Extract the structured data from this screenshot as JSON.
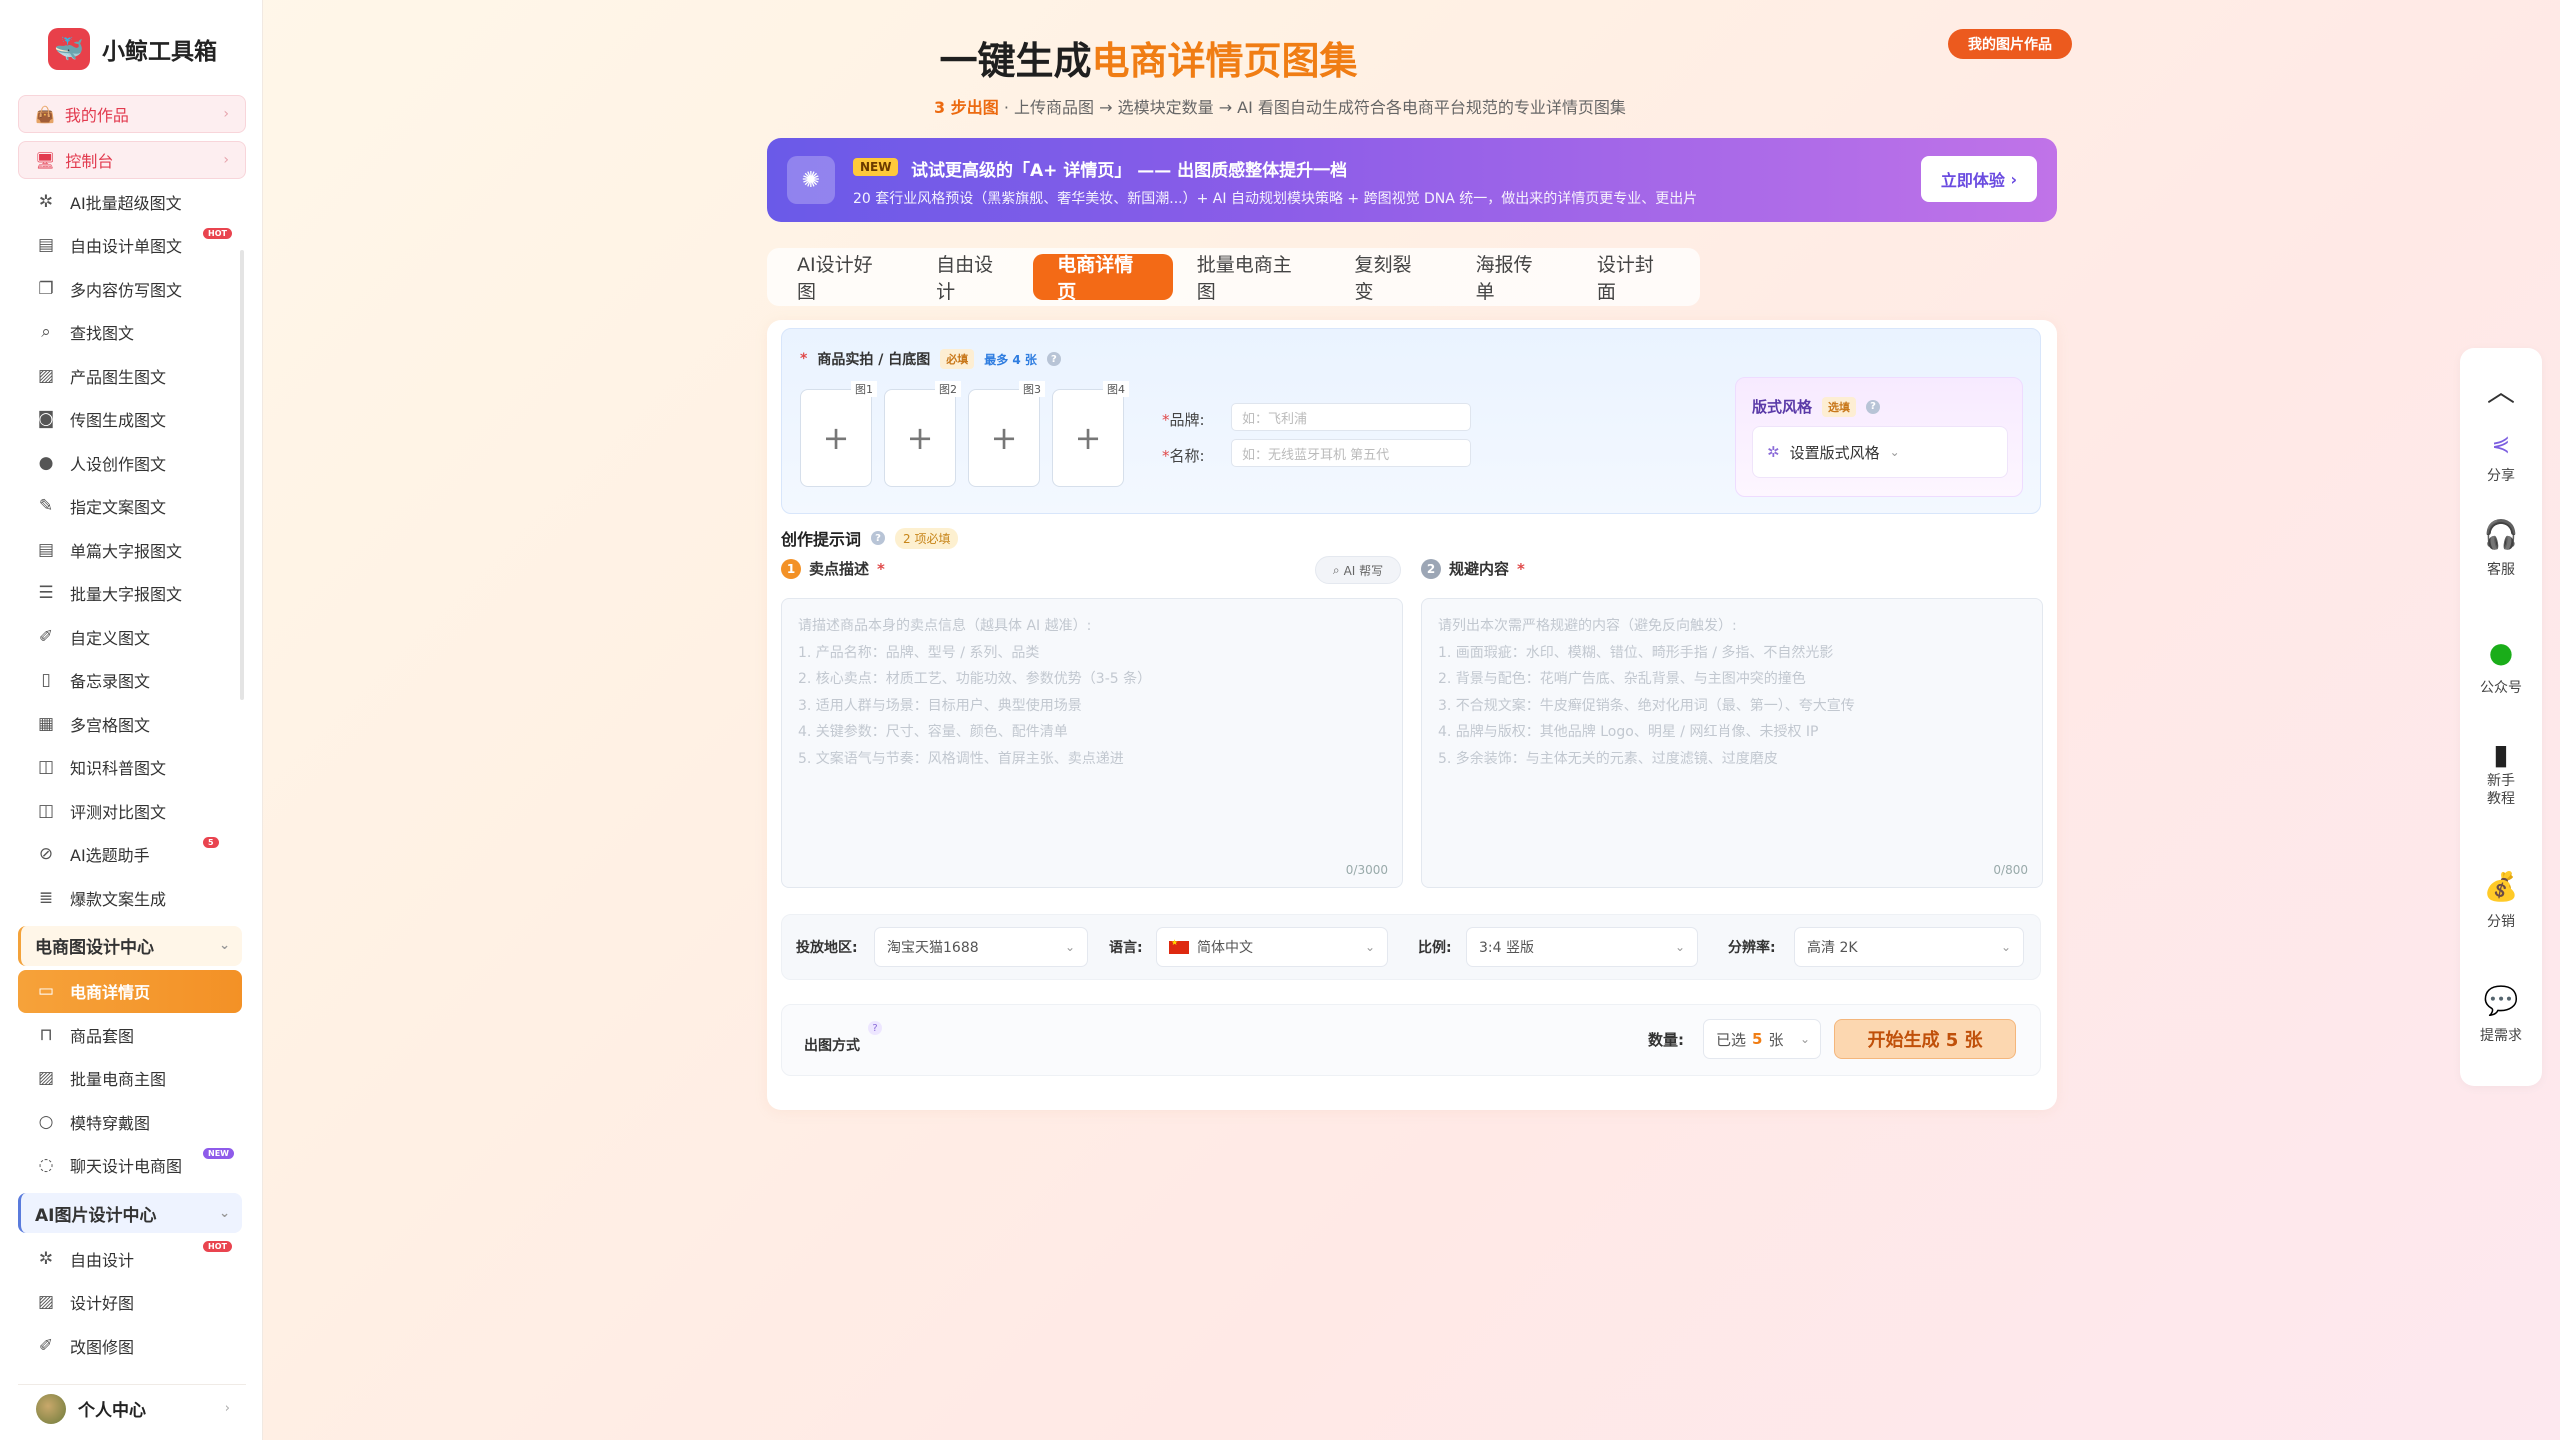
{
  "app": {
    "name": "小鲸工具箱"
  },
  "sidebar": {
    "pills": [
      {
        "label": "我的作品"
      },
      {
        "label": "控制台"
      }
    ],
    "items": [
      {
        "label": "AI批量超级图文",
        "icon": "sparkle-icon"
      },
      {
        "label": "自由设计单图文",
        "icon": "document-icon",
        "badge": "HOT"
      },
      {
        "label": "多内容仿写图文",
        "icon": "copy-icon"
      },
      {
        "label": "查找图文",
        "icon": "search-icon"
      },
      {
        "label": "产品图生图文",
        "icon": "image-icon"
      },
      {
        "label": "传图生成图文",
        "icon": "camera-icon"
      },
      {
        "label": "人设创作图文",
        "icon": "person-icon"
      },
      {
        "label": "指定文案图文",
        "icon": "edit-icon"
      },
      {
        "label": "单篇大字报图文",
        "icon": "document-icon"
      },
      {
        "label": "批量大字报图文",
        "icon": "stack-icon"
      },
      {
        "label": "自定义图文",
        "icon": "pen-icon"
      },
      {
        "label": "备忘录图文",
        "icon": "notebook-icon"
      },
      {
        "label": "多宫格图文",
        "icon": "grid-icon"
      },
      {
        "label": "知识科普图文",
        "icon": "book-icon"
      },
      {
        "label": "评测对比图文",
        "icon": "book-icon"
      },
      {
        "label": "AI选题助手",
        "icon": "compass-icon",
        "badge": "5"
      },
      {
        "label": "爆款文案生成",
        "icon": "list-icon"
      }
    ],
    "section1": {
      "label": "电商图设计中心"
    },
    "section1_items": [
      {
        "label": "电商详情页",
        "icon": "layers-icon"
      },
      {
        "label": "商品套图",
        "icon": "bag-icon"
      },
      {
        "label": "批量电商主图",
        "icon": "image-icon"
      },
      {
        "label": "模特穿戴图",
        "icon": "person-icon"
      },
      {
        "label": "聊天设计电商图",
        "icon": "chat-icon",
        "badge": "NEW"
      }
    ],
    "section2": {
      "label": "AI图片设计中心"
    },
    "section2_items": [
      {
        "label": "自由设计",
        "icon": "sparkle-icon",
        "badge": "HOT"
      },
      {
        "label": "设计好图",
        "icon": "image-icon"
      },
      {
        "label": "改图修图",
        "icon": "pen-icon"
      }
    ],
    "user": {
      "label": "个人中心"
    }
  },
  "header": {
    "title_main": "一键生成",
    "title_accent": "电商详情页图集",
    "subtitle_accent": "3 步出图",
    "subtitle_rest": " · 上传商品图 → 选模块定数量 → AI 看图自动生成符合各电商平台规范的专业详情页图集",
    "my_works": "我的图片作品"
  },
  "banner": {
    "tag": "NEW",
    "title": "试试更高级的「A+ 详情页」 —— 出图质感整体提升一档",
    "subtitle": "20 套行业风格预设（黑紫旗舰、奢华美妆、新国潮...）+ AI 自动规划模块策略 + 跨图视觉 DNA 统一，做出来的详情页更专业、更出片",
    "button": "立即体验"
  },
  "tabs": [
    {
      "label": "AI设计好图"
    },
    {
      "label": "自由设计"
    },
    {
      "label": "电商详情页"
    },
    {
      "label": "批量电商主图"
    },
    {
      "label": "复刻裂变"
    },
    {
      "label": "海报传单"
    },
    {
      "label": "设计封面"
    }
  ],
  "upload": {
    "label": "商品实拍 / 白底图",
    "required_tag": "必填",
    "max_tag": "最多 4 张",
    "slots": [
      "图1",
      "图2",
      "图3",
      "图4"
    ],
    "brand_label": "品牌:",
    "brand_placeholder": "如：飞利浦",
    "name_label": "名称:",
    "name_placeholder": "如：无线蓝牙耳机 第五代",
    "style_title": "版式风格",
    "style_tag": "选填",
    "style_button": "设置版式风格"
  },
  "prompt": {
    "title": "创作提示词",
    "required_tag": "2 项必填",
    "selling": {
      "num": "1",
      "title": "卖点描述",
      "ai_button": "AI 帮写",
      "placeholder_lines": [
        "请描述商品本身的卖点信息（越具体 AI 越准）:",
        "1. 产品名称：品牌、型号 / 系列、品类",
        "2. 核心卖点：材质工艺、功能功效、参数优势（3-5 条）",
        "3. 适用人群与场景：目标用户、典型使用场景",
        "4. 关键参数：尺寸、容量、颜色、配件清单",
        "5. 文案语气与节奏：风格调性、首屏主张、卖点递进"
      ],
      "count": "0/3000"
    },
    "avoid": {
      "num": "2",
      "title": "规避内容",
      "placeholder_lines": [
        "请列出本次需严格规避的内容（避免反向触发）:",
        "1. 画面瑕疵：水印、模糊、错位、畸形手指 / 多指、不自然光影",
        "2. 背景与配色：花哨广告底、杂乱背景、与主图冲突的撞色",
        "3. 不合规文案：牛皮癣促销条、绝对化用词（最、第一）、夸大宣传",
        "4. 品牌与版权：其他品牌 Logo、明星 / 网红肖像、未授权 IP",
        "5. 多余装饰：与主体无关的元素、过度滤镜、过度磨皮"
      ],
      "count": "0/800"
    }
  },
  "options": {
    "region_label": "投放地区:",
    "region_value": "淘宝天猫1688",
    "lang_label": "语言:",
    "lang_value": "简体中文",
    "ratio_label": "比例:",
    "ratio_value": "3:4 竖版",
    "res_label": "分辨率:",
    "res_value": "高清 2K"
  },
  "generate": {
    "mode_label": "出图方式",
    "qty_label": "数量:",
    "qty_prefix": "已选",
    "qty_value": "5",
    "qty_suffix": "张",
    "button": "开始生成 5 张"
  },
  "dock": [
    {
      "label": "分享",
      "icon": "share-icon"
    },
    {
      "label": "客服",
      "icon": "headset-icon"
    },
    {
      "label": "公众号",
      "icon": "wechat-icon"
    },
    {
      "label": "新手\n教程",
      "icon": "book-icon"
    },
    {
      "label": "分销",
      "icon": "money-bag-icon"
    },
    {
      "label": "提需求",
      "icon": "chat-icon"
    }
  ],
  "colors": {
    "accent": "#f36a16",
    "banner": "#8c5de8",
    "danger": "#e23b4f"
  }
}
